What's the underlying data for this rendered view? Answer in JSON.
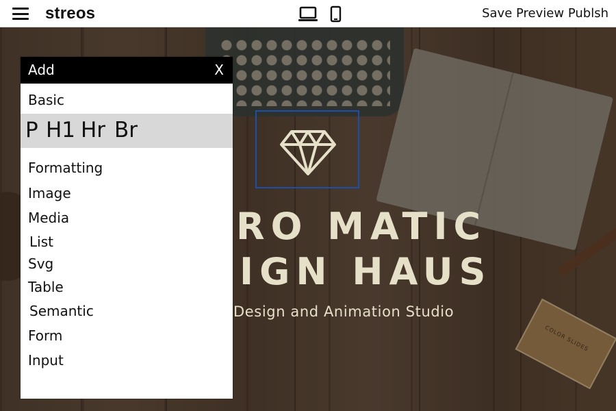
{
  "app": {
    "brand": "streos"
  },
  "toolbar": {
    "devices": [
      "desktop-icon",
      "mobile-icon"
    ],
    "actions": {
      "save": "Save",
      "preview": "Preview",
      "publish": "Publsh"
    }
  },
  "canvas": {
    "hero_line1": "RO MATIC",
    "hero_line2": "IGN HAUS",
    "hero_subtitle": "Design and Animation Studio",
    "logo_icon": "diamond-icon",
    "box_label": "COLOR SLIDES"
  },
  "add_panel": {
    "title": "Add",
    "close_label": "X",
    "basic_label": "Basic",
    "basic_items": [
      "P",
      "H1",
      "Hr",
      "Br"
    ],
    "categories": [
      "Formatting",
      "Image",
      "Media",
      "List",
      "Svg",
      "Table",
      "Semantic",
      "Form",
      "Input"
    ]
  },
  "colors": {
    "accent_outline": "#1d4fa8",
    "hero_text": "#e6e0c9",
    "panel_header": "#000000",
    "basic_highlight": "#d8d8d8"
  }
}
